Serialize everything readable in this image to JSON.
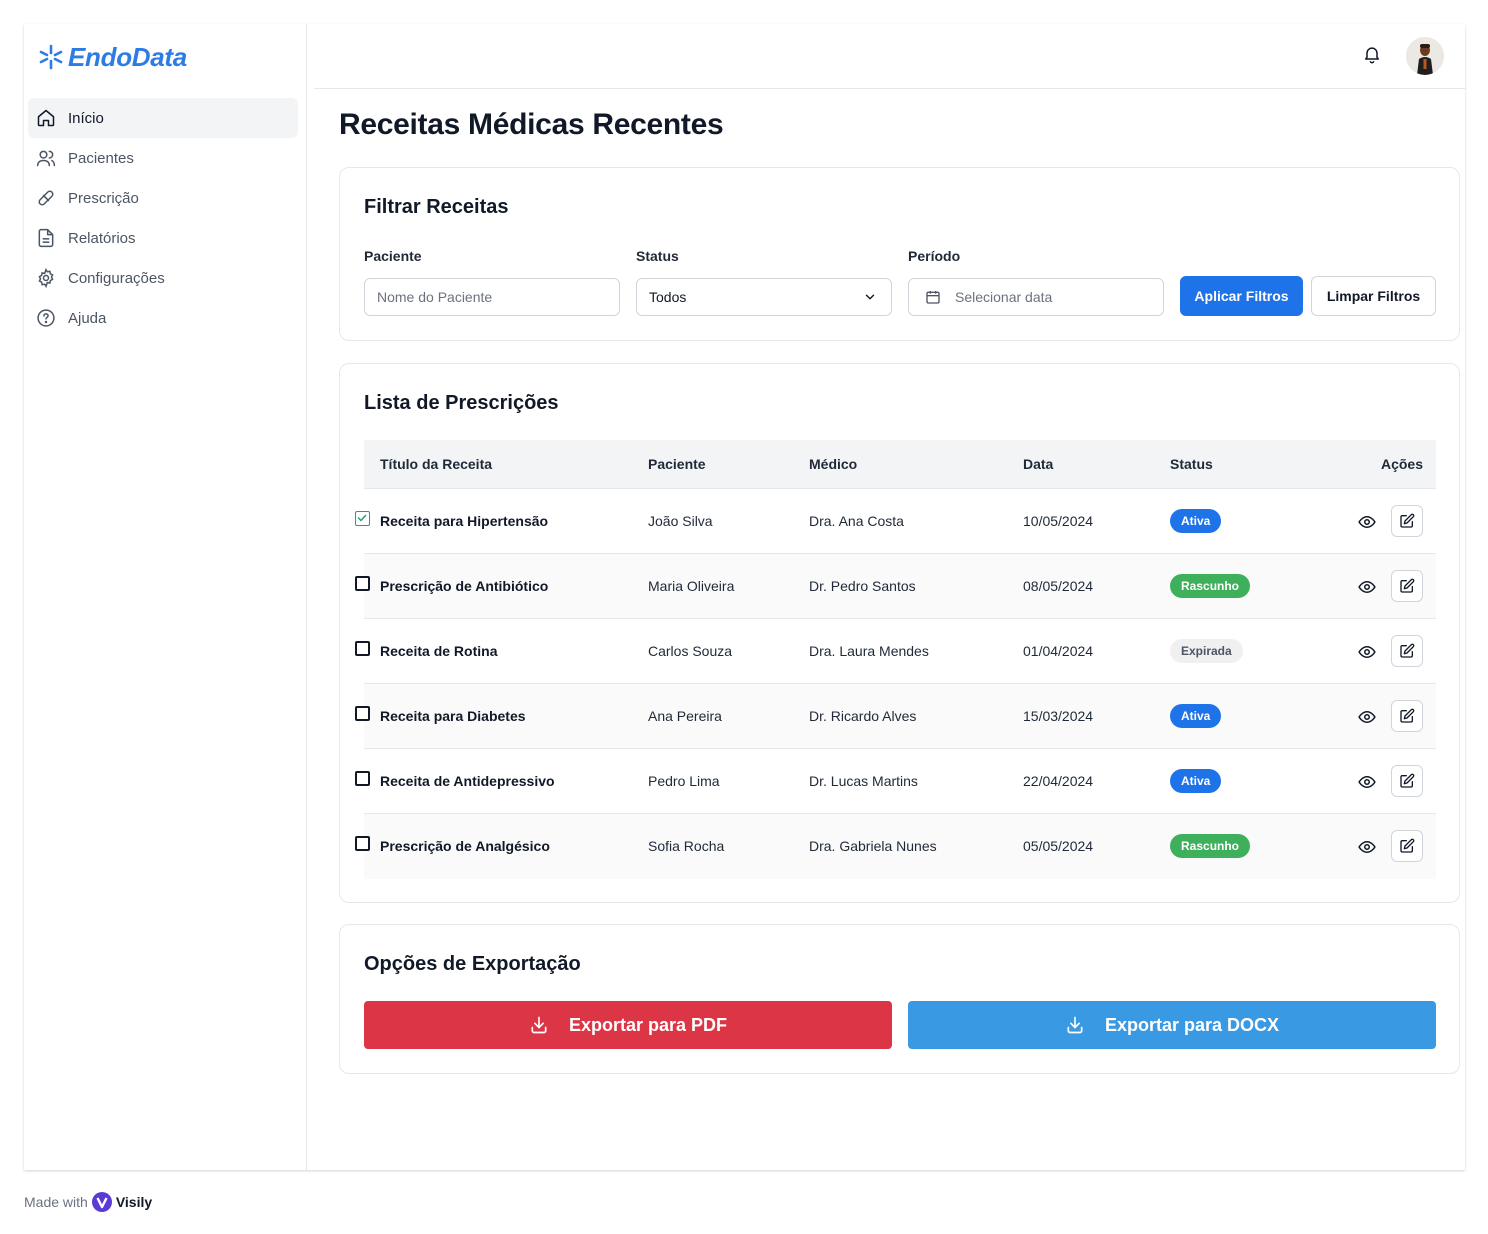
{
  "app": {
    "name": "EndoData",
    "accent": "#2d7be5"
  },
  "sidebar": {
    "items": [
      {
        "label": "Início",
        "icon": "home-icon",
        "active": true
      },
      {
        "label": "Pacientes",
        "icon": "users-icon"
      },
      {
        "label": "Prescrição",
        "icon": "pill-icon"
      },
      {
        "label": "Relatórios",
        "icon": "file-text-icon"
      },
      {
        "label": "Configurações",
        "icon": "gear-icon"
      },
      {
        "label": "Ajuda",
        "icon": "help-circle-icon"
      }
    ]
  },
  "header": {
    "bell_icon": "bell-icon",
    "avatar": "user-avatar"
  },
  "page": {
    "title": "Receitas Médicas Recentes"
  },
  "filters": {
    "title": "Filtrar Receitas",
    "patient_label": "Paciente",
    "patient_placeholder": "Nome do Paciente",
    "status_label": "Status",
    "status_value": "Todos",
    "period_label": "Período",
    "period_placeholder": "Selecionar data",
    "apply_label": "Aplicar Filtros",
    "clear_label": "Limpar Filtros"
  },
  "prescriptions": {
    "title": "Lista de Prescrições",
    "columns": {
      "title": "Título da Receita",
      "patient": "Paciente",
      "doctor": "Médico",
      "date": "Data",
      "status": "Status",
      "actions": "Ações"
    },
    "rows": [
      {
        "checked": true,
        "title": "Receita para Hipertensão",
        "patient": "João Silva",
        "doctor": "Dra. Ana Costa",
        "date": "10/05/2024",
        "status": "Ativa",
        "status_type": "ativa"
      },
      {
        "checked": false,
        "title": "Prescrição de Antibiótico",
        "patient": "Maria Oliveira",
        "doctor": "Dr. Pedro Santos",
        "date": "08/05/2024",
        "status": "Rascunho",
        "status_type": "rascunho"
      },
      {
        "checked": false,
        "title": "Receita de Rotina",
        "patient": "Carlos Souza",
        "doctor": "Dra. Laura Mendes",
        "date": "01/04/2024",
        "status": "Expirada",
        "status_type": "expirada"
      },
      {
        "checked": false,
        "title": "Receita para Diabetes",
        "patient": "Ana Pereira",
        "doctor": "Dr. Ricardo Alves",
        "date": "15/03/2024",
        "status": "Ativa",
        "status_type": "ativa"
      },
      {
        "checked": false,
        "title": "Receita de Antidepressivo",
        "patient": "Pedro Lima",
        "doctor": "Dr. Lucas Martins",
        "date": "22/04/2024",
        "status": "Ativa",
        "status_type": "ativa"
      },
      {
        "checked": false,
        "title": "Prescrição de Analgésico",
        "patient": "Sofia Rocha",
        "doctor": "Dra. Gabriela Nunes",
        "date": "05/05/2024",
        "status": "Rascunho",
        "status_type": "rascunho"
      }
    ]
  },
  "export": {
    "title": "Opções de Exportação",
    "pdf_label": "Exportar para PDF",
    "docx_label": "Exportar para DOCX",
    "pdf_color": "#dc3545",
    "docx_color": "#3a99e3"
  },
  "footer": {
    "made_with": "Made with",
    "brand": "Visily"
  }
}
